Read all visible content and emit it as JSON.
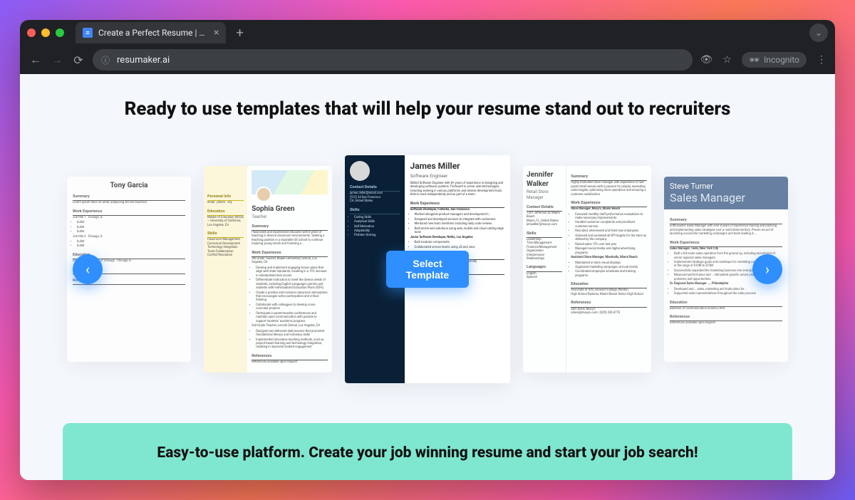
{
  "browser": {
    "tab_title": "Create a Perfect Resume | Fr…",
    "url": "resumaker.ai",
    "incognito_label": "Incognito"
  },
  "page": {
    "heading": "Ready to use templates that will help your resume stand out to recruiters",
    "select_button": "Select Template",
    "band": "Easy-to-use platform. Create your job winning resume and start your job search!"
  },
  "templates": [
    {
      "name": "Tony Garcia",
      "title": "",
      "sections": {
        "summary": "Summary",
        "work": "Work Experience",
        "education": "Education",
        "languages": "Languages",
        "references": "References"
      },
      "jobs": [
        "Job title 1 · Chicago, IL",
        "Job title 2 · Chicago, IL"
      ],
      "edu": [
        "Bachelor · University of Chicago · Chicago, IL"
      ]
    },
    {
      "name": "Sophia Green",
      "title": "Teacher",
      "sidebar": {
        "personal": "Personal Info",
        "education": "Education",
        "skills": "Skills"
      },
      "sections": {
        "summary": "Summary",
        "work": "Work Experience",
        "references": "References"
      },
      "edu": [
        "Master of Education (M.Ed) — University of California, Los Angeles, CA"
      ],
      "skills": [
        "Classroom Management",
        "Curriculum Development",
        "Technology Integration",
        "Team Collaboration",
        "Conflict Resolution"
      ],
      "jobs": [
        "5th Grade Teacher, Maple Elementary School, Los Angeles, CA",
        "2nd Grade Teacher, Lincoln School, Los Angeles, CA"
      ],
      "ref": "References available upon request"
    },
    {
      "name": "James Miller",
      "title": "Software Engineer",
      "sidebar_sections": {
        "contact": "Contact Details",
        "skills": "Skills"
      },
      "contact": [
        "james.miller@email.com",
        "(512) 34 San Francisco",
        "CA, United States"
      ],
      "skills": [
        "Coding Skills",
        "Analytical Skills",
        "Self Motivation",
        "Adaptability",
        "Problem Solving"
      ],
      "summary": "Skilled Software Engineer with 8+ years of experience in designing and developing software systems. Proficient in server side technologies including working in various platforms and diverse development tools. Able to work independently and as part of a team.",
      "sections": {
        "work": "Work Experience",
        "education": "Education",
        "references": "References"
      },
      "jobs": [
        {
          "role": "Software Developer, Fintecha, San Francisco",
          "bullets": [
            "Worked alongside product managers and development t…",
            "Designed and developed services to integrate with customers",
            "Mentored new team members including daily code reviews",
            "Built end-to-end solutions using web, mobile and cloud cutting edge tools"
          ]
        },
        {
          "role": "Junior Software Developer, Nettix, Los Angeles",
          "bullets": [
            "Built modular components",
            "Collaborated across teams using JS and Java"
          ]
        }
      ],
      "edu": "Bachelor of Computer Science, Stanford University",
      "ref": "References available upon request"
    },
    {
      "name": "Jennifer Walker",
      "title": "Retail Store Manager",
      "sidebar_sections": {
        "contact": "Contact Details",
        "skills": "Skills",
        "languages": "Languages"
      },
      "contact": [
        "1201 Jefferson St, Miami Beach",
        "Miami, FL, United States",
        "jenwalker@macys.com"
      ],
      "skills": [
        "Leadership",
        "Time Management",
        "Financial Management",
        "Organization",
        "Interpersonal Relationships"
      ],
      "languages": [
        "English",
        "Spanish"
      ],
      "sections": {
        "summary": "Summary",
        "work": "Work Experience",
        "education": "Education",
        "references": "References"
      },
      "summary": "Highly motivated store manager with experience in fast-paced retail venues with a passion for people, exceeding sales targets, optimizing store operations and ensuring a customer satisfaction.",
      "jobs": [
        {
          "role": "Store Manager, Macy's, Miami Beach",
          "bullets": [
            "Executed monthly staff performance evaluations to make necessary improvements",
            "Handled customer complaints and prioritized customer service",
            "Recruited, interviewed and hired new employees",
            "Achieved and exceeded all KPI targets for the store as defined by the company",
            "Raised sales 15% over last year",
            "Managed social media and digital advertising programs"
          ]
        },
        {
          "role": "Assistant Store Manager, Marshalls, Miami Beach",
          "bullets": [
            "Maintained in-store visual displays",
            "Organized marketing campaigns at local events",
            "Coordinated employee schedules and training programs"
          ]
        }
      ],
      "edu": [
        "Associate of Arts, Broward College, Weston",
        "High School Diploma, Miami Beach Senior High School"
      ],
      "references": [
        "Sam Devis, Macy's",
        "sdevis@macys.com | (305) 236-6776"
      ]
    },
    {
      "name": "Steve Turner",
      "title": "Sales Manager",
      "sections": {
        "summary": "Summary",
        "work": "Work Experience",
        "education": "Education",
        "references": "References"
      },
      "summary": "Enthusiastic Sales Manager with over 8 years of experience training and planning and implementing sales strategies over a multi-state territory. Proven record of launching successful marketing campaigns and team leading in …",
      "jobs": [
        {
          "role": "Sales Manager, Tesla, New York City",
          "bullets": [
            "Built a full-scale sales operation from the ground up, including recruitment of senior regional sales managers",
            "Implemented strategic goals and roadmaps for marketing campaigns with billing in the range of $10M to $15M",
            "Successfully expanded the marketing business into emerging …",
            "Measured performance and … stimulated specific action plans to address problems and opportunities"
          ]
        },
        {
          "role": "Sr. Regional Sales Manager … , Philadelphia",
          "bullets": [
            "Developed and … sales, marketing and trade plans for …",
            "Supported sales representatives throughout the sales process"
          ]
        }
      ],
      "edu": "Bachelor of Communication Science, NYU",
      "ref": "References available upon request"
    }
  ]
}
